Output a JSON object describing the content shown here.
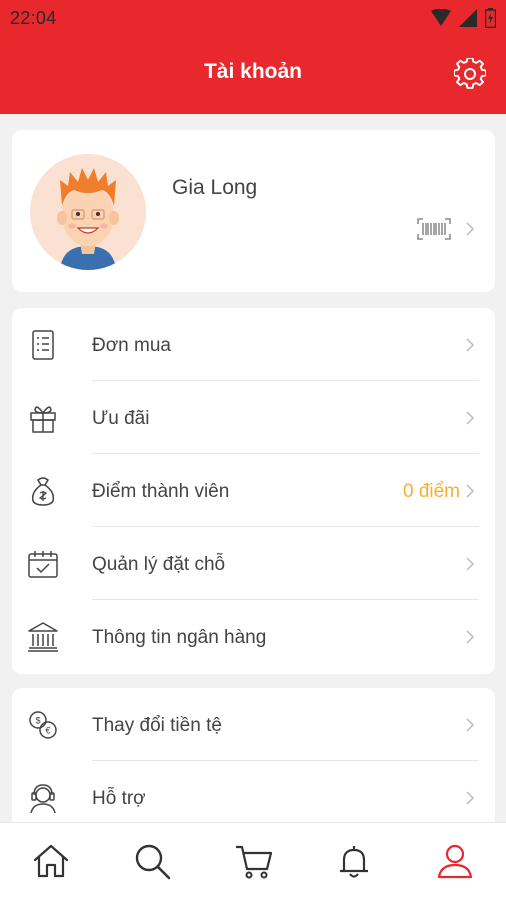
{
  "status_bar": {
    "time": "22:04",
    "icons": [
      "wifi-icon",
      "signal-icon",
      "battery-icon"
    ]
  },
  "header": {
    "title": "Tài khoản",
    "settings_icon": "gear-icon"
  },
  "profile": {
    "name": "Gia Long",
    "avatar_icon": "user-avatar",
    "barcode_icon": "barcode-icon"
  },
  "menu_main": [
    {
      "label": "Đơn mua",
      "icon": "orders-list-icon"
    },
    {
      "label": "Ưu đãi",
      "icon": "gift-icon"
    },
    {
      "label": "Điểm thành viên",
      "icon": "money-bag-icon",
      "value": "0 điểm"
    },
    {
      "label": "Quản lý đặt chỗ",
      "icon": "calendar-icon"
    },
    {
      "label": "Thông tin ngân hàng",
      "icon": "bank-icon"
    }
  ],
  "menu_secondary": [
    {
      "label": "Thay đổi tiền tệ",
      "icon": "currency-exchange-icon"
    },
    {
      "label": "Hỗ trợ",
      "icon": "support-agent-icon"
    }
  ],
  "bottom_nav": [
    {
      "icon": "home-icon"
    },
    {
      "icon": "search-icon"
    },
    {
      "icon": "cart-icon"
    },
    {
      "icon": "bell-icon"
    },
    {
      "icon": "profile-icon",
      "active": true
    }
  ],
  "colors": {
    "brand_red": "#e8282c",
    "accent_yellow": "#f4b030",
    "background": "#f1f1f1",
    "active_tab": "#e8282c"
  }
}
